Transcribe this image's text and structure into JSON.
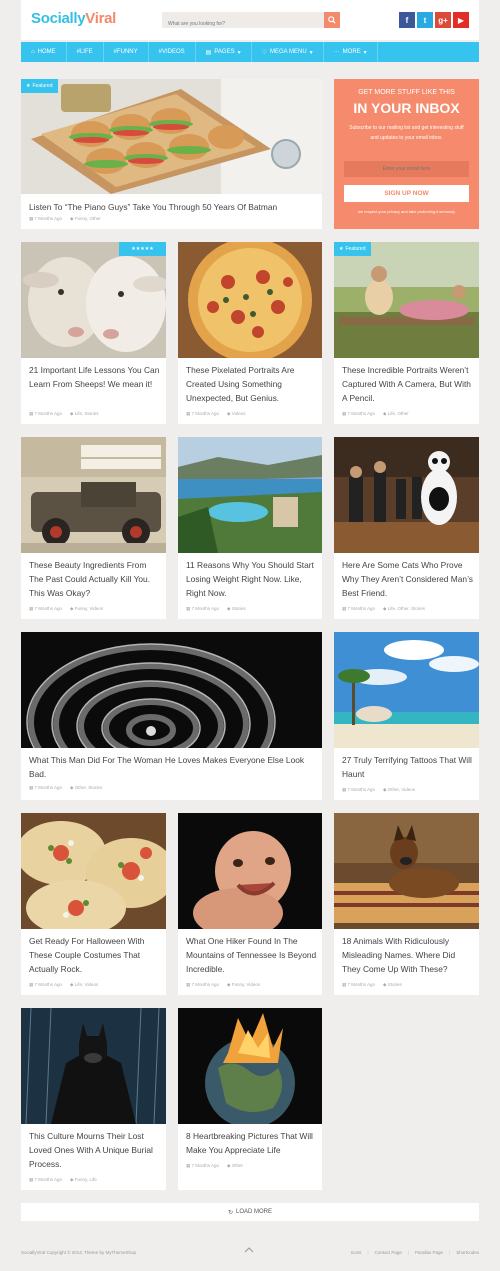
{
  "header": {
    "logo_part1": "Socially",
    "logo_part2": "Viral",
    "search_placeholder": "What are you looking for?",
    "social": [
      {
        "icon": "facebook-icon",
        "glyph": "f",
        "color": "#3b5998"
      },
      {
        "icon": "twitter-icon",
        "glyph": "t",
        "color": "#28a9e2"
      },
      {
        "icon": "google-plus-icon",
        "glyph": "g+",
        "color": "#dc4a38"
      },
      {
        "icon": "youtube-icon",
        "glyph": "▶",
        "color": "#e32c26"
      }
    ]
  },
  "nav": {
    "home": "HOME",
    "life": "#LIFE",
    "funny": "#FUNNY",
    "videos": "#VIDEOS",
    "pages": "PAGES",
    "mega": "MEGA MENU",
    "more": "MORE"
  },
  "newsletter": {
    "small": "GET MORE STUFF LIKE THIS",
    "big": "IN YOUR INBOX",
    "desc": "Subscribe to our mailing list and get interesting stuff and updates to your email inbox.",
    "email_placeholder": "Enter your email here",
    "button": "SIGN UP NOW",
    "note": "we respect your privacy and take protecting it seriously"
  },
  "featured_label": "Featured",
  "posts": [
    {
      "title": "Listen To “The Piano Guys” Take You Through 50 Years Of Batman",
      "time": "7 Months Ago",
      "cats": "Funny, Other"
    },
    {
      "title": "21 Important Life Lessons You Can Learn From Sheeps! We mean it!",
      "time": "7 Months Ago",
      "cats": "Life, Stories",
      "rating": "★★★★★"
    },
    {
      "title": "These Pixelated Portraits Are Created Using Something Unexpected, But Genius.",
      "time": "7 Months Ago",
      "cats": "Videos"
    },
    {
      "title": "These Incredible Portraits Weren’t Captured With A Camera, But With A Pencil.",
      "time": "7 Months Ago",
      "cats": "Life, Other"
    },
    {
      "title": "These Beauty Ingredients From The Past Could Actually Kill You. This Was Okay?",
      "time": "7 Months Ago",
      "cats": "Funny, Videos"
    },
    {
      "title": "11 Reasons Why You Should Start Losing Weight Right Now. Like, Right Now.",
      "time": "7 Months Ago",
      "cats": "Stories"
    },
    {
      "title": "Here Are Some Cats Who Prove Why They Aren’t Considered Man’s Best Friend.",
      "time": "7 Months Ago",
      "cats": "Life, Other, Stories"
    },
    {
      "title": "What This Man Did For The Woman He Loves Makes Everyone Else Look Bad.",
      "time": "7 Months Ago",
      "cats": "Other, Stories"
    },
    {
      "title": "27 Truly Terrifying Tattoos That Will Haunt",
      "time": "7 Months Ago",
      "cats": "Other, Videos"
    },
    {
      "title": "Get Ready For Halloween With These Couple Costumes That Actually Rock.",
      "time": "7 Months Ago",
      "cats": "Life, Videos"
    },
    {
      "title": "What One Hiker Found In The Mountains of Tennessee Is Beyond Incredible.",
      "time": "7 Months Ago",
      "cats": "Funny, Videos"
    },
    {
      "title": "18 Animals With Ridiculously Misleading Names. Where Did They Come Up With These?",
      "time": "7 Months Ago",
      "cats": "Stories"
    },
    {
      "title": "This Culture Mourns Their Lost Loved Ones With A Unique Burial Process.",
      "time": "7 Months Ago",
      "cats": "Funny, Life"
    },
    {
      "title": "8 Heartbreaking Pictures That Will Make You Appreciate Life",
      "time": "7 Months Ago",
      "cats": "Other"
    }
  ],
  "load_more": "LOAD MORE",
  "footer": {
    "copyright": "SociallyViral Copyright © 2014. Theme by MyThemeShop",
    "links": [
      "Icons",
      "Contact Page",
      "Parallax Page",
      "Shortcodes"
    ]
  }
}
